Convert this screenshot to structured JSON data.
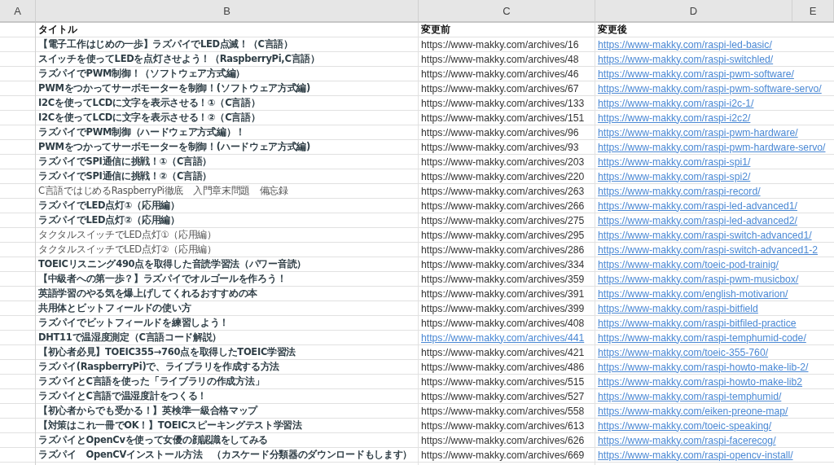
{
  "columns": [
    "A",
    "B",
    "C",
    "D",
    "E"
  ],
  "header": {
    "title": "タイトル",
    "before": "変更前",
    "after": "変更後"
  },
  "rows": [
    {
      "title": "【電子工作はじめの一歩】ラズパイでLED点滅！（C言語）",
      "bold": true,
      "before": "https://www-makky.com/archives/16",
      "before_link": false,
      "after": "https://www-makky.com/raspi-led-basic/"
    },
    {
      "title": "スイッチを使ってLEDを点灯させよう！（RaspberryPi,C言語）",
      "bold": true,
      "before": "https://www-makky.com/archives/48",
      "before_link": false,
      "after": "https://www-makky.com/raspi-switchled/"
    },
    {
      "title": "ラズパイでPWM制御！（ソフトウェア方式編）",
      "bold": true,
      "before": "https://www-makky.com/archives/46",
      "before_link": false,
      "after": "https://www-makky.com/raspi-pwm-software/"
    },
    {
      "title": "PWMをつかってサーボモーターを制御！(ソフトウェア方式編)",
      "bold": true,
      "before": "https://www-makky.com/archives/67",
      "before_link": false,
      "after": "https://www-makky.com/raspi-pwm-software-servo/"
    },
    {
      "title": "I2Cを使ってLCDに文字を表示させる！①（C言語）",
      "bold": true,
      "before": "https://www-makky.com/archives/133",
      "before_link": false,
      "after": "https://www-makky.com/raspi-i2c-1/"
    },
    {
      "title": "I2Cを使ってLCDに文字を表示させる！②（C言語）",
      "bold": true,
      "before": "https://www-makky.com/archives/151",
      "before_link": false,
      "after": "https://www-makky.com/raspi-i2c2/"
    },
    {
      "title": "ラズパイでPWM制御（ハードウェア方式編）！",
      "bold": true,
      "before": "https://www-makky.com/archives/96",
      "before_link": false,
      "after": "https://www-makky.com/raspi-pwm-hardware/"
    },
    {
      "title": "PWMをつかってサーボモーターを制御！(ハードウェア方式編)",
      "bold": true,
      "before": "https://www-makky.com/archives/93",
      "before_link": false,
      "after": "https://www-makky.com/raspi-pwm-hardware-servo/"
    },
    {
      "title": "ラズパイでSPI通信に挑戦！①（C言語）",
      "bold": true,
      "before": "https://www-makky.com/archives/203",
      "before_link": false,
      "after": "https://www-makky.com/raspi-spi1/"
    },
    {
      "title": "ラズパイでSPI通信に挑戦！②（C言語）",
      "bold": true,
      "before": "https://www-makky.com/archives/220",
      "before_link": false,
      "after": "https://www-makky.com/raspi-spi2/"
    },
    {
      "title": "C言語ではじめるRaspberryPi徹底　入門章末問題　備忘録",
      "bold": false,
      "before": "https://www-makky.com/archives/263",
      "before_link": false,
      "after": "https://www-makky.com/raspi-record/"
    },
    {
      "title": "ラズパイでLED点灯①（応用編）",
      "bold": true,
      "before": "https://www-makky.com/archives/266",
      "before_link": false,
      "after": "https://www-makky.com/raspi-led-advanced1/"
    },
    {
      "title": "ラズパイでLED点灯②（応用編）",
      "bold": true,
      "before": "https://www-makky.com/archives/275",
      "before_link": false,
      "after": "https://www-makky.com/raspi-led-advanced2/"
    },
    {
      "title": "タクタルスイッチでLED点灯①（応用編）",
      "bold": false,
      "before": "https://www-makky.com/archives/295",
      "before_link": false,
      "after": "https://www-makky.com/raspi-switch-advanced1/"
    },
    {
      "title": "タクタルスイッチでLED点灯②（応用編）",
      "bold": false,
      "before": "https://www-makky.com/archives/286",
      "before_link": false,
      "after": "https://www-makky.com/raspi-switch-advanced1-2"
    },
    {
      "title": "TOEICリスニング490点を取得した音読学習法（パワー音読）",
      "bold": true,
      "before": "https://www-makky.com/archives/334",
      "before_link": false,
      "after": "https://www-makky.com/toeic-pod-trainig/"
    },
    {
      "title": "【中級者への第一歩？】ラズパイでオルゴールを作ろう！",
      "bold": true,
      "before": "https://www-makky.com/archives/359",
      "before_link": false,
      "after": "https://www-makky.com/raspi-pwm-musicbox/"
    },
    {
      "title": "英語学習のやる気を爆上げしてくれるおすすめの本",
      "bold": true,
      "before": "https://www-makky.com/archives/391",
      "before_link": false,
      "after": "https://www-makky.com/english-motivarion/"
    },
    {
      "title": "共用体とビットフィールドの使い方",
      "bold": true,
      "before": "https://www-makky.com/archives/399",
      "before_link": false,
      "after": "https://www-makky.com/raspi-bitfield"
    },
    {
      "title": "ラズパイでビットフィールドを練習しよう！",
      "bold": true,
      "before": "https://www-makky.com/archives/408",
      "before_link": false,
      "after": "https://www-makky.com/raspi-bitfiled-practice"
    },
    {
      "title": "DHT11で温湿度測定（C言語コード解説）",
      "bold": true,
      "before": "https://www-makky.com/archives/441",
      "before_link": true,
      "after": "https://www-makky.com/raspi-temphumid-code/"
    },
    {
      "title": "【初心者必見】TOEIC355→760点を取得したTOEIC学習法",
      "bold": true,
      "before": "https://www-makky.com/archives/421",
      "before_link": false,
      "after": "https://www-makky.com/toeic-355-760/"
    },
    {
      "title": "ラズパイ(RaspberryPi)で、ライブラリを作成する方法",
      "bold": true,
      "before": "https://www-makky.com/archives/486",
      "before_link": false,
      "after": "https://www-makky.com/raspi-howto-make-lib-2/"
    },
    {
      "title": "ラズパイとC言語を使った「ライブラリの作成方法」",
      "bold": true,
      "before": "https://www-makky.com/archives/515",
      "before_link": false,
      "after": "https://www-makky.com/raspi-howto-make-lib2"
    },
    {
      "title": "ラズパイとC言語で温湿度計をつくる！",
      "bold": true,
      "before": "https://www-makky.com/archives/527",
      "before_link": false,
      "after": "https://www-makky.com/raspi-temphumid/"
    },
    {
      "title": "【初心者からでも受かる！】英検準一級合格マップ",
      "bold": true,
      "before": "https://www-makky.com/archives/558",
      "before_link": false,
      "after": "https://www-makky.com/eiken-preone-map/"
    },
    {
      "title": "【対策はこれ一冊でOK！】TOEICスピーキングテスト学習法",
      "bold": true,
      "before": "https://www-makky.com/archives/613",
      "before_link": false,
      "after": "https://www-makky.com/toeic-speaking/"
    },
    {
      "title": "ラズパイとOpenCvを使って女優の顔認識をしてみる",
      "bold": true,
      "before": "https://www-makky.com/archives/626",
      "before_link": false,
      "after": "https://www-makky.com/raspi-facerecog/"
    },
    {
      "title": "ラズパイ　OpenCVインストール方法　（カスケード分類器のダウンロードもします）",
      "bold": true,
      "before": "https://www-makky.com/archives/669",
      "before_link": false,
      "after": "https://www-makky.com/raspi-opencv-install/"
    }
  ]
}
